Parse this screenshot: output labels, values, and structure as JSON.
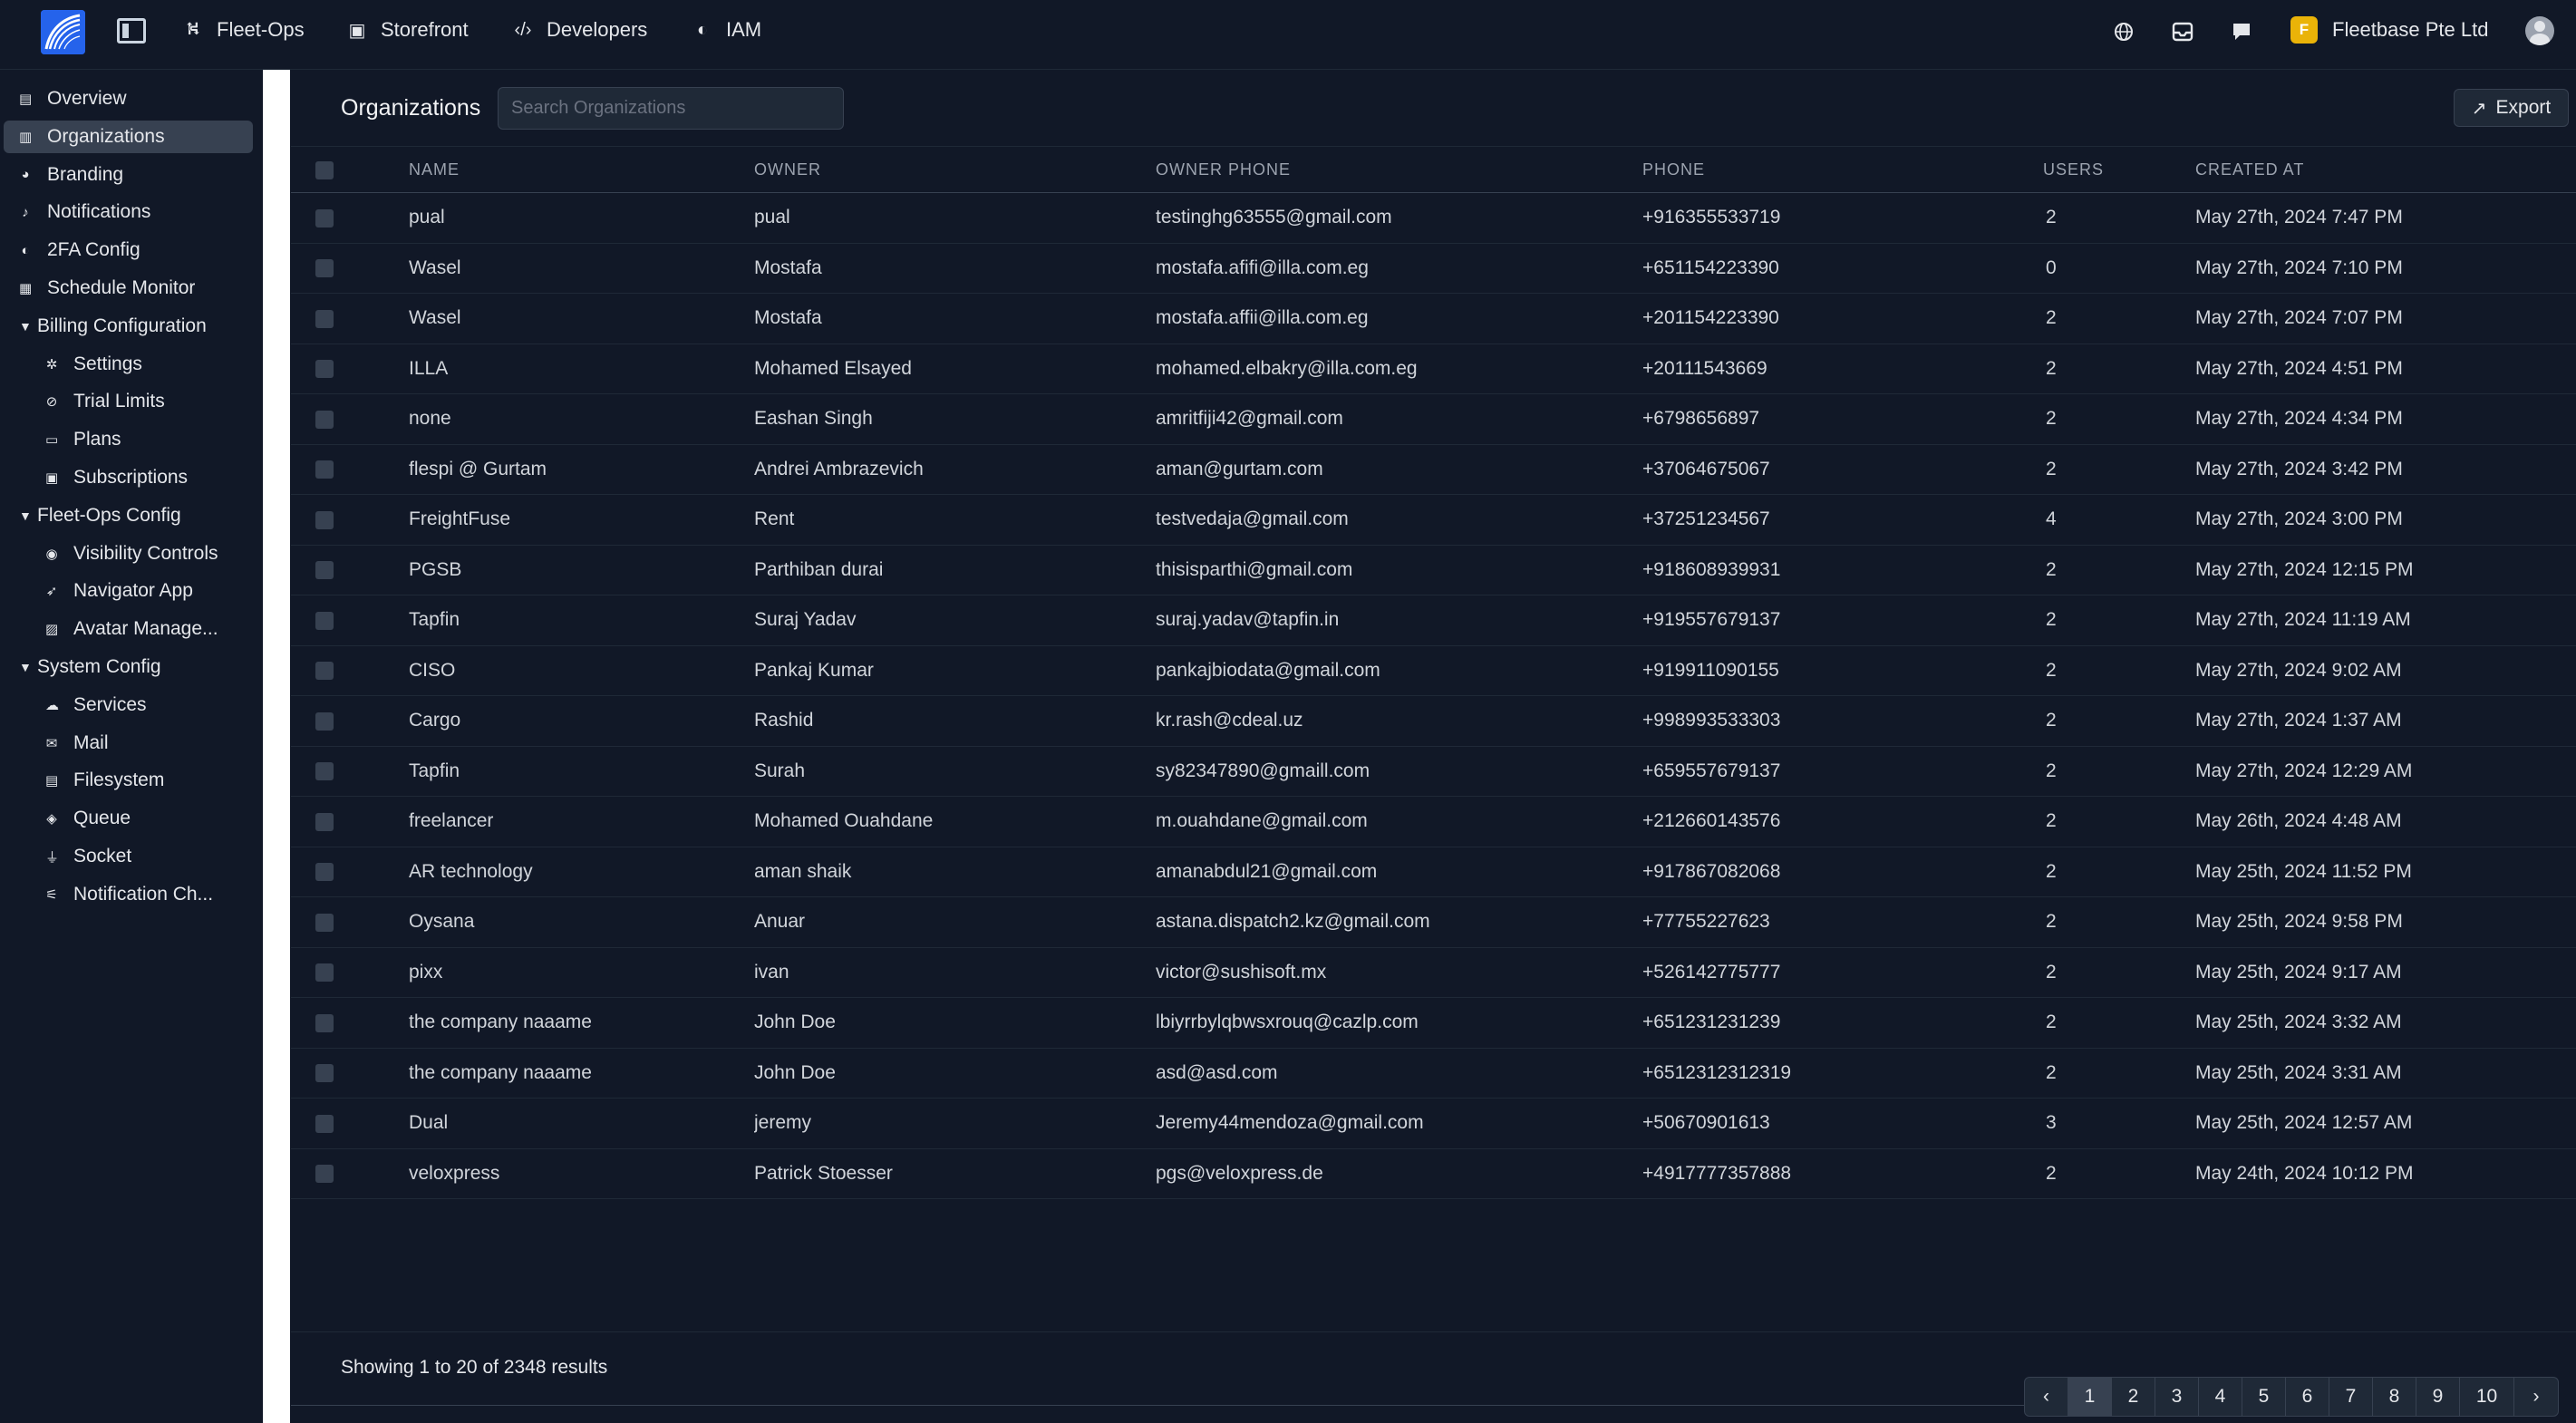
{
  "topbar": {
    "nav": [
      {
        "label": "Fleet-Ops",
        "icon": "route-icon"
      },
      {
        "label": "Storefront",
        "icon": "store-icon"
      },
      {
        "label": "Developers",
        "icon": "code-icon"
      },
      {
        "label": "IAM",
        "icon": "shield-icon"
      }
    ],
    "company_initial": "F",
    "company_name": "Fleetbase Pte Ltd"
  },
  "sidebar": {
    "items": [
      {
        "label": "Overview",
        "icon": "overview-icon",
        "type": "item"
      },
      {
        "label": "Organizations",
        "icon": "building-icon",
        "type": "item",
        "active": true
      },
      {
        "label": "Branding",
        "icon": "palette-icon",
        "type": "item"
      },
      {
        "label": "Notifications",
        "icon": "bell-icon",
        "type": "item"
      },
      {
        "label": "2FA Config",
        "icon": "shield-icon",
        "type": "item"
      },
      {
        "label": "Schedule Monitor",
        "icon": "calendar-icon",
        "type": "item"
      },
      {
        "label": "Billing Configuration",
        "type": "group"
      },
      {
        "label": "Settings",
        "icon": "gear-icon",
        "type": "child"
      },
      {
        "label": "Trial Limits",
        "icon": "ban-icon",
        "type": "child"
      },
      {
        "label": "Plans",
        "icon": "card-icon",
        "type": "child"
      },
      {
        "label": "Subscriptions",
        "icon": "money-icon",
        "type": "child"
      },
      {
        "label": "Fleet-Ops Config",
        "type": "group"
      },
      {
        "label": "Visibility Controls",
        "icon": "eye-icon",
        "type": "child"
      },
      {
        "label": "Navigator App",
        "icon": "location-arrow-icon",
        "type": "child"
      },
      {
        "label": "Avatar Manage...",
        "icon": "image-icon",
        "type": "child"
      },
      {
        "label": "System Config",
        "type": "group"
      },
      {
        "label": "Services",
        "icon": "cloud-icon",
        "type": "child"
      },
      {
        "label": "Mail",
        "icon": "envelope-icon",
        "type": "child"
      },
      {
        "label": "Filesystem",
        "icon": "database-icon",
        "type": "child"
      },
      {
        "label": "Queue",
        "icon": "layers-icon",
        "type": "child"
      },
      {
        "label": "Socket",
        "icon": "plug-icon",
        "type": "child"
      },
      {
        "label": "Notification Ch...",
        "icon": "broadcast-icon",
        "type": "child"
      }
    ]
  },
  "main": {
    "title": "Organizations",
    "search_placeholder": "Search Organizations",
    "export_label": "Export",
    "columns": [
      "Name",
      "Owner",
      "Owner Phone",
      "Phone",
      "Users",
      "Created At"
    ],
    "rows": [
      [
        "pual",
        "pual",
        "testinghg63555@gmail.com",
        "+916355533719",
        "2",
        "May 27th, 2024 7:47 PM"
      ],
      [
        "Wasel",
        "Mostafa",
        "mostafa.afifi@illa.com.eg",
        "+651154223390",
        "0",
        "May 27th, 2024 7:10 PM"
      ],
      [
        "Wasel",
        "Mostafa",
        "mostafa.affii@illa.com.eg",
        "+201154223390",
        "2",
        "May 27th, 2024 7:07 PM"
      ],
      [
        "ILLA",
        "Mohamed Elsayed",
        "mohamed.elbakry@illa.com.eg",
        "+20111543669",
        "2",
        "May 27th, 2024 4:51 PM"
      ],
      [
        "none",
        "Eashan Singh",
        "amritfiji42@gmail.com",
        "+6798656897",
        "2",
        "May 27th, 2024 4:34 PM"
      ],
      [
        "flespi @ Gurtam",
        "Andrei Ambrazevich",
        "aman@gurtam.com",
        "+37064675067",
        "2",
        "May 27th, 2024 3:42 PM"
      ],
      [
        "FreightFuse",
        "Rent",
        "testvedaja@gmail.com",
        "+37251234567",
        "4",
        "May 27th, 2024 3:00 PM"
      ],
      [
        "PGSB",
        "Parthiban durai",
        "thisisparthi@gmail.com",
        "+918608939931",
        "2",
        "May 27th, 2024 12:15 PM"
      ],
      [
        "Tapfin",
        "Suraj Yadav",
        "suraj.yadav@tapfin.in",
        "+919557679137",
        "2",
        "May 27th, 2024 11:19 AM"
      ],
      [
        "CISO",
        "Pankaj Kumar",
        "pankajbiodata@gmail.com",
        "+919911090155",
        "2",
        "May 27th, 2024 9:02 AM"
      ],
      [
        "Cargo",
        "Rashid",
        "kr.rash@cdeal.uz",
        "+998993533303",
        "2",
        "May 27th, 2024 1:37 AM"
      ],
      [
        "Tapfin",
        "Surah",
        "sy82347890@gmaill.com",
        "+659557679137",
        "2",
        "May 27th, 2024 12:29 AM"
      ],
      [
        "freelancer",
        "Mohamed Ouahdane",
        "m.ouahdane@gmail.com",
        "+212660143576",
        "2",
        "May 26th, 2024 4:48 AM"
      ],
      [
        "AR technology",
        "aman shaik",
        "amanabdul21@gmail.com",
        "+917867082068",
        "2",
        "May 25th, 2024 11:52 PM"
      ],
      [
        "Oysana",
        "Anuar",
        "astana.dispatch2.kz@gmail.com",
        "+77755227623",
        "2",
        "May 25th, 2024 9:58 PM"
      ],
      [
        "pixx",
        "ivan",
        "victor@sushisoft.mx",
        "+526142775777",
        "2",
        "May 25th, 2024 9:17 AM"
      ],
      [
        "the company naaame",
        "John Doe",
        "lbiyrrbylqbwsxrouq@cazlp.com",
        "+651231231239",
        "2",
        "May 25th, 2024 3:32 AM"
      ],
      [
        "the company naaame",
        "John Doe",
        "asd@asd.com",
        "+6512312312319",
        "2",
        "May 25th, 2024 3:31 AM"
      ],
      [
        "Dual",
        "jeremy",
        "Jeremy44mendoza@gmail.com",
        "+50670901613",
        "3",
        "May 25th, 2024 12:57 AM"
      ],
      [
        "veloxpress",
        "Patrick Stoesser",
        "pgs@veloxpress.de",
        "+4917777357888",
        "2",
        "May 24th, 2024 10:12 PM"
      ]
    ],
    "results_text": "Showing 1 to 20 of 2348 results",
    "pages": [
      "1",
      "2",
      "3",
      "4",
      "5",
      "6",
      "7",
      "8",
      "9",
      "10"
    ],
    "current_page": "1"
  }
}
